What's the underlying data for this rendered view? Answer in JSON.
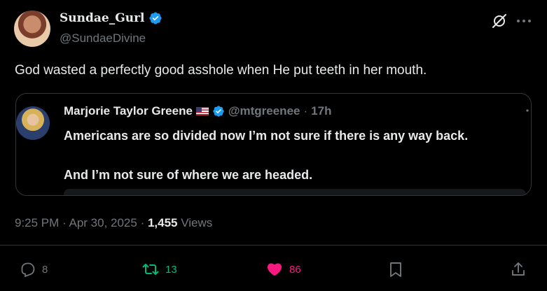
{
  "author": {
    "display_name": "Sundae_Gurl",
    "handle": "@SundaeDivine"
  },
  "tweet_text": "God wasted a perfectly good asshole when He put teeth in her mouth.",
  "quote": {
    "display_name": "Marjorie Taylor Greene",
    "handle": "@mtgreenee",
    "separator": "·",
    "time": "17h",
    "line1": "Americans are so divided now I’m not sure if there is any way back.",
    "line2": "And I’m not sure of where we are headed."
  },
  "meta": {
    "time": "9:25 PM",
    "dot1": " · ",
    "date": "Apr 30, 2025",
    "dot2": " · ",
    "views_count": "1,455",
    "views_label": " Views"
  },
  "actions": {
    "replies": "8",
    "reposts": "13",
    "likes": "86"
  },
  "colors": {
    "background": "#000000",
    "text": "#e7e9ea",
    "muted": "#71767b",
    "verified": "#1d9bf0",
    "repost": "#00ba7c",
    "like": "#f91880",
    "border": "#333639"
  },
  "icons": {
    "verified": "verified-badge-icon",
    "grok": "grok-icon",
    "more": "more-icon",
    "reply": "reply-icon",
    "repost": "repost-icon",
    "like": "heart-icon",
    "bookmark": "bookmark-icon",
    "share": "share-icon"
  }
}
